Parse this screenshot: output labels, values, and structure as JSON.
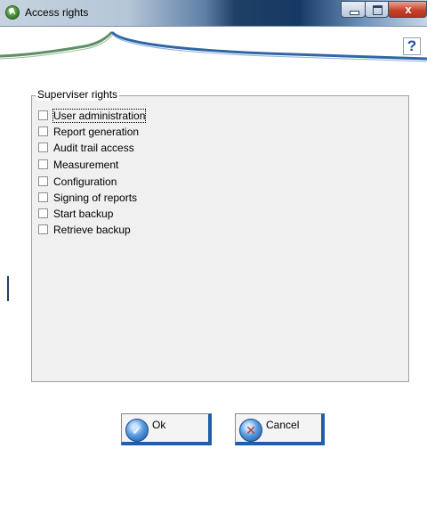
{
  "window": {
    "title": "Access rights",
    "close_glyph": "x",
    "app_icon": "app-logo-icon"
  },
  "header": {
    "help_glyph": "?",
    "help_icon": "help-icon"
  },
  "supervisor_group": {
    "title": "Superviser rights",
    "items": [
      {
        "label": "User administration",
        "checked": false,
        "focused": true
      },
      {
        "label": "Report generation",
        "checked": false
      },
      {
        "label": "Audit trail access",
        "checked": false
      },
      {
        "label": "Measurement",
        "checked": false
      },
      {
        "label": "Configuration",
        "checked": false
      },
      {
        "label": "Signing of reports",
        "checked": false
      },
      {
        "label": "Start backup",
        "checked": false
      },
      {
        "label": "Retrieve backup",
        "checked": false
      }
    ]
  },
  "buttons": {
    "ok_label": "Ok",
    "cancel_label": "Cancel",
    "ok_icon": "checkmark-icon",
    "cancel_icon": "cancel-x-icon"
  },
  "colors": {
    "accent": "#1f5ea8",
    "group_background": "#f0f0f0",
    "close_button": "#c8432d"
  }
}
